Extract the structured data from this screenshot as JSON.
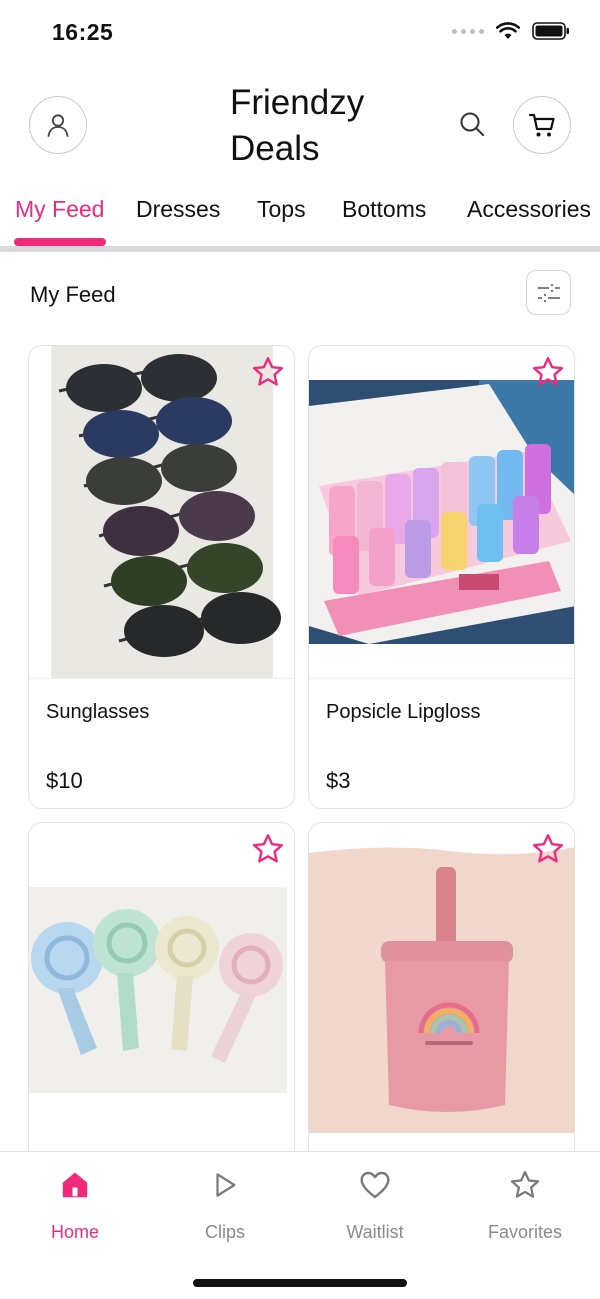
{
  "status_bar": {
    "time": "16:25"
  },
  "header": {
    "title_line1": "Friendzy",
    "title_line2": "Deals",
    "profile_icon": "person-icon",
    "search_icon": "search-icon",
    "cart_icon": "cart-icon"
  },
  "tabs": [
    {
      "label": "My Feed",
      "active": true
    },
    {
      "label": "Dresses",
      "active": false
    },
    {
      "label": "Tops",
      "active": false
    },
    {
      "label": "Bottoms",
      "active": false
    },
    {
      "label": "Accessories",
      "active": false
    }
  ],
  "feed": {
    "title": "My Feed",
    "filter_icon": "sliders-icon"
  },
  "products": [
    {
      "name": "Sunglasses",
      "price": "$10",
      "image": "stacked aviator sunglasses"
    },
    {
      "name": "Popsicle Lipgloss",
      "price": "$3",
      "image": "box of popsicle lipgloss"
    },
    {
      "name": "",
      "price": "",
      "image": "four pastel handheld fans"
    },
    {
      "name": "",
      "price": "",
      "image": "pink sippy cup with rainbow"
    }
  ],
  "bottom_nav": [
    {
      "label": "Home",
      "icon": "home-icon",
      "active": true
    },
    {
      "label": "Clips",
      "icon": "play-icon",
      "active": false
    },
    {
      "label": "Waitlist",
      "icon": "heart-icon",
      "active": false
    },
    {
      "label": "Favorites",
      "icon": "star-icon",
      "active": false
    }
  ],
  "colors": {
    "accent": "#ef2a7e",
    "text": "#111111",
    "muted": "#8a8a8a",
    "border": "#e1e1e1"
  }
}
